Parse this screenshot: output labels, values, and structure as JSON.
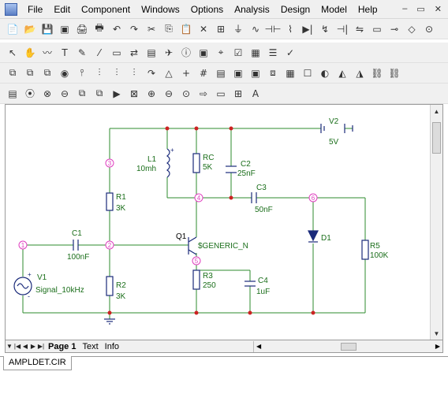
{
  "menu": [
    "File",
    "Edit",
    "Component",
    "Windows",
    "Options",
    "Analysis",
    "Design",
    "Model",
    "Help"
  ],
  "window_controls": [
    "–",
    "▭",
    "✕"
  ],
  "toolbar1": [
    "📄",
    "📂",
    "💾",
    "▣",
    "🖨",
    "🖶",
    "↶",
    "↷",
    "✂",
    "⎘",
    "📋",
    "✕",
    "⊞",
    "⏚",
    "∿",
    "⊣⊢",
    "⌇",
    "▶|",
    "↯",
    "⊣|",
    "⇋",
    "▭",
    "⊸",
    "◇",
    "⊙"
  ],
  "toolbar2": [
    "↖",
    "✋",
    "〰",
    "T",
    "✎",
    "⁄",
    "▭",
    "⇄",
    "▤",
    "✈",
    "ⓘ",
    "▣",
    "⌖",
    "☑",
    "▦",
    "☰",
    "✓"
  ],
  "toolbar3": [
    "⧉",
    "⧉",
    "⧉",
    "◉",
    "⫯",
    "⫶",
    "⫶",
    "⫶",
    "↷",
    "△",
    "+",
    "#",
    "▤",
    "▣",
    "▣",
    "⧈",
    "▦",
    "☐",
    "◐",
    "◭",
    "◮",
    "⛓",
    "⛓"
  ],
  "toolbar4": [
    "▤",
    "⦿",
    "⊗",
    "⊖",
    "⧉",
    "⧉",
    "▶",
    "⊠",
    "⊕",
    "⊖",
    "⊙",
    "⇨",
    "▭",
    "⊞",
    "A"
  ],
  "schematic": {
    "nodes": [
      "1",
      "2",
      "3",
      "4",
      "5",
      "6"
    ],
    "components": {
      "V2": {
        "name": "V2",
        "value": "5V"
      },
      "L1": {
        "name": "L1",
        "value": "10mh"
      },
      "RC": {
        "name": "RC",
        "value": "5K"
      },
      "C2": {
        "name": "C2",
        "value": "25nF"
      },
      "C3": {
        "name": "C3",
        "value": "50nF"
      },
      "R1": {
        "name": "R1",
        "value": "3K"
      },
      "C1": {
        "name": "C1",
        "value": "100nF"
      },
      "Q1": {
        "name": "Q1",
        "value": "$GENERIC_N"
      },
      "D1": {
        "name": "D1",
        "value": ""
      },
      "R5": {
        "name": "R5",
        "value": "100K"
      },
      "V1": {
        "name": "V1",
        "value": "Signal_10kHz"
      },
      "R2": {
        "name": "R2",
        "value": "3K"
      },
      "R3": {
        "name": "R3",
        "value": "250"
      },
      "C4": {
        "name": "C4",
        "value": "1uF"
      }
    },
    "plus_sign": "+",
    "minus_sign": "-"
  },
  "page_tabs": [
    "Page 1",
    "Text",
    "Info"
  ],
  "document_tab": "AMPLDET.CIR",
  "colors": {
    "wire": "#2e8b2e",
    "node_dot": "#cc2222",
    "node_label": "#e040c0",
    "component": "#1a2a7a",
    "label_text": "#1a6e1a"
  }
}
